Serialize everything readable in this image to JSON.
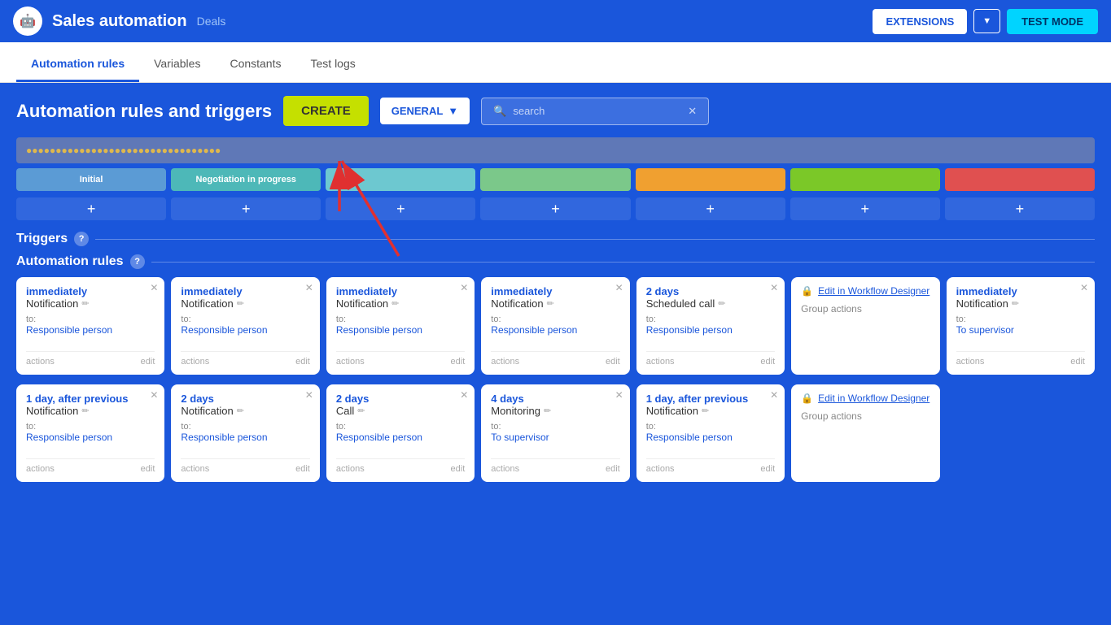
{
  "header": {
    "logo": "🤖",
    "title": "Sales automation",
    "subtitle": "Deals",
    "extensions_label": "EXTENSIONS",
    "testmode_label": "TEST MODE"
  },
  "tabs": [
    {
      "label": "Automation rules",
      "active": true
    },
    {
      "label": "Variables",
      "active": false
    },
    {
      "label": "Constants",
      "active": false
    },
    {
      "label": "Test logs",
      "active": false
    }
  ],
  "main": {
    "section_title": "Automation rules and triggers",
    "create_label": "CREATE",
    "general_label": "GENERAL",
    "search_placeholder": "search",
    "triggers_label": "Triggers",
    "automation_rules_label": "Automation rules"
  },
  "stages": [
    {
      "label": "Initial",
      "class": "stage-1"
    },
    {
      "label": "Negotiation in progress",
      "class": "stage-2"
    },
    {
      "label": "",
      "class": "stage-3"
    },
    {
      "label": "",
      "class": "stage-4"
    },
    {
      "label": "",
      "class": "stage-5"
    },
    {
      "label": "",
      "class": "stage-6"
    },
    {
      "label": "",
      "class": "stage-7"
    }
  ],
  "rule_cards_row1": [
    {
      "time": "immediately",
      "type": "Notification",
      "to_label": "to:",
      "person": "Responsible person",
      "actions_label": "actions",
      "edit_label": "edit",
      "has_close": true
    },
    {
      "time": "immediately",
      "type": "Notification",
      "to_label": "to:",
      "person": "Responsible person",
      "actions_label": "actions",
      "edit_label": "edit",
      "has_close": true
    },
    {
      "time": "immediately",
      "type": "Notification",
      "to_label": "to:",
      "person": "Responsible person",
      "actions_label": "actions",
      "edit_label": "edit",
      "has_close": true
    },
    {
      "time": "immediately",
      "type": "Notification",
      "to_label": "to:",
      "person": "Responsible person",
      "actions_label": "actions",
      "edit_label": "edit",
      "has_close": true
    },
    {
      "time": "2 days",
      "type": "Scheduled call",
      "to_label": "to:",
      "person": "Responsible person",
      "actions_label": "actions",
      "edit_label": "edit",
      "has_close": true
    },
    {
      "workflow": true,
      "lock_icon": "🔒",
      "workflow_link": "Edit in Workflow Designer",
      "group_actions": "Group actions"
    },
    {
      "time": "immediately",
      "type": "Notification",
      "to_label": "to:",
      "person": "To supervisor",
      "actions_label": "actions",
      "edit_label": "edit",
      "has_close": true
    }
  ],
  "rule_cards_row2": [
    {
      "time": "1 day, after previous",
      "type": "Notification",
      "to_label": "to:",
      "person": "Responsible person",
      "actions_label": "actions",
      "edit_label": "edit",
      "has_close": true
    },
    {
      "time": "2 days",
      "type": "Notification",
      "to_label": "to:",
      "person": "Responsible person",
      "actions_label": "actions",
      "edit_label": "edit",
      "has_close": true
    },
    {
      "time": "2 days",
      "type": "Call",
      "to_label": "to:",
      "person": "Responsible person",
      "actions_label": "actions",
      "edit_label": "edit",
      "has_close": true
    },
    {
      "time": "4 days",
      "type": "Monitoring",
      "to_label": "to:",
      "person": "To supervisor",
      "actions_label": "actions",
      "edit_label": "edit",
      "has_close": true
    },
    {
      "time": "1 day, after previous",
      "type": "Notification",
      "to_label": "to:",
      "person": "Responsible person",
      "actions_label": "actions",
      "edit_label": "edit",
      "has_close": true
    },
    {
      "workflow": true,
      "lock_icon": "🔒",
      "workflow_link": "Edit in Workflow Designer",
      "group_actions": "Group actions"
    },
    {
      "empty": true
    }
  ]
}
